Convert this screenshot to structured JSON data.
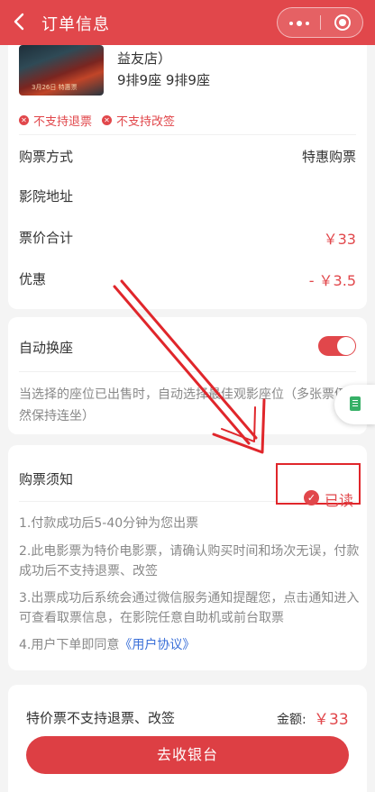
{
  "header": {
    "title": "订单信息",
    "back_icon": "chevron-left-icon",
    "more_icon": "more-dots-icon",
    "close_icon": "target-circle-icon"
  },
  "order": {
    "poster_text": "3月26日 特惠票",
    "cinema_tail": "益友店）",
    "seats": "9排9座  9排9座",
    "tags": [
      "不支持退票",
      "不支持改签"
    ],
    "rows": [
      {
        "label": "购票方式",
        "value": "特惠购票"
      },
      {
        "label": "影院地址",
        "value": ""
      },
      {
        "label": "票价合计",
        "value": "￥33"
      },
      {
        "label": "优惠",
        "value": "- ￥3.5"
      }
    ]
  },
  "auto_seat": {
    "label": "自动换座",
    "enabled": true,
    "hint": "当选择的座位已出售时，自动选择最佳观影座位（多张票仍然保持连坐）"
  },
  "notice": {
    "title": "购票须知",
    "read_label": "已读",
    "items": [
      "1.付款成功后5-40分钟为您出票",
      "2.此电影票为特价电影票，请确认购买时间和场次无误，付款成功后不支持退票、改签",
      "3.出票成功后系统会通过微信服务通知提醒您，点击通知进入可查看取票信息，在影院任意自助机或前台取票"
    ],
    "agreement_prefix": "4.用户下单即同意",
    "agreement_link": "《用户协议》"
  },
  "footer": {
    "note": "特价票不支持退票、改签",
    "amount_label": "金额:",
    "amount_value": "￥33",
    "checkout_label": "去收银台"
  },
  "colors": {
    "brand": "#e1474b",
    "link": "#3a6fd8",
    "annotation": "#e0262b"
  }
}
